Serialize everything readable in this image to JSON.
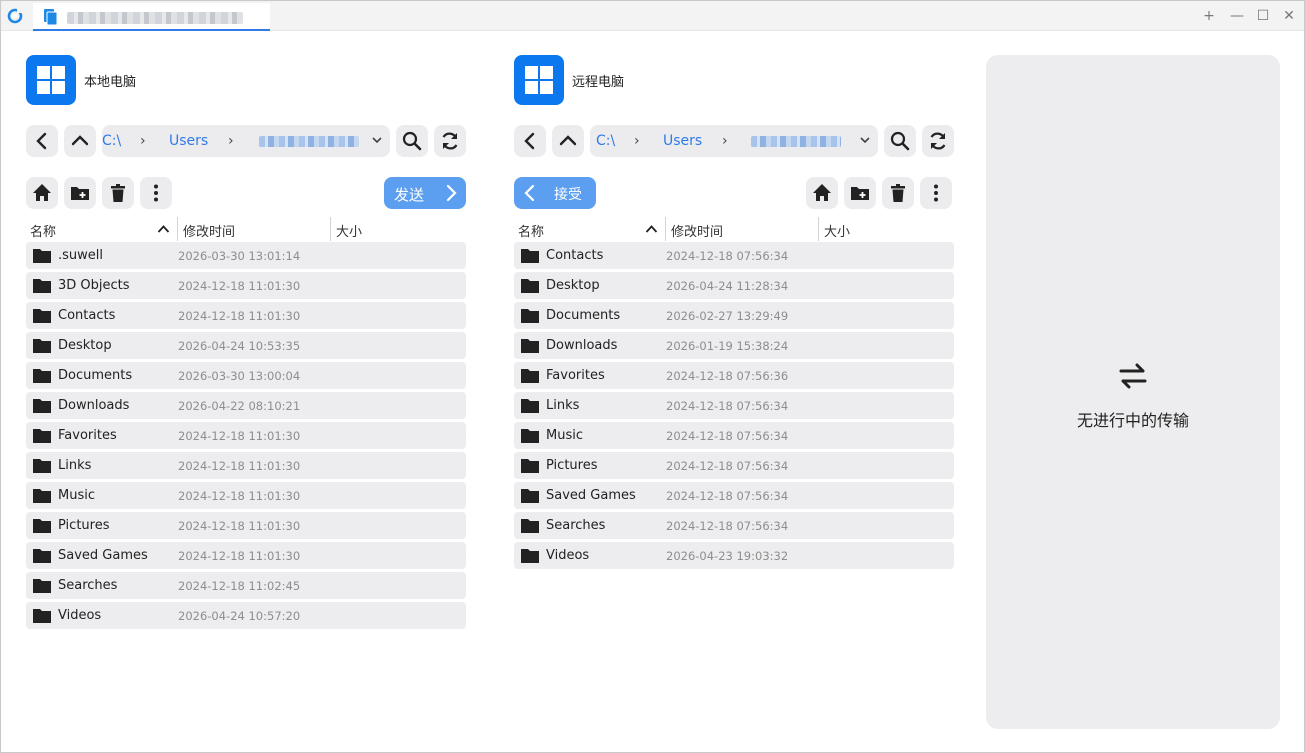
{
  "titlebar": {
    "tab_title": "",
    "new_tab": "+",
    "minimize": "—",
    "maximize": "☐",
    "close": "✕"
  },
  "colors": {
    "accent": "#2f7be8",
    "windows_blue": "#0b78f0",
    "button_blue": "#5c9ff0",
    "row_bg": "#ededef"
  },
  "local": {
    "title": "本地电脑",
    "path": {
      "drive": "C:\\",
      "folder": "Users"
    },
    "send_label": "发送",
    "columns": {
      "name": "名称",
      "modified": "修改时间",
      "size": "大小"
    },
    "files": [
      {
        "name": ".suwell",
        "date": "2026-03-30 13:01:14"
      },
      {
        "name": "3D Objects",
        "date": "2024-12-18 11:01:30"
      },
      {
        "name": "Contacts",
        "date": "2024-12-18 11:01:30"
      },
      {
        "name": "Desktop",
        "date": "2026-04-24 10:53:35"
      },
      {
        "name": "Documents",
        "date": "2026-03-30 13:00:04"
      },
      {
        "name": "Downloads",
        "date": "2026-04-22 08:10:21"
      },
      {
        "name": "Favorites",
        "date": "2024-12-18 11:01:30"
      },
      {
        "name": "Links",
        "date": "2024-12-18 11:01:30"
      },
      {
        "name": "Music",
        "date": "2024-12-18 11:01:30"
      },
      {
        "name": "Pictures",
        "date": "2024-12-18 11:01:30"
      },
      {
        "name": "Saved Games",
        "date": "2024-12-18 11:01:30"
      },
      {
        "name": "Searches",
        "date": "2024-12-18 11:02:45"
      },
      {
        "name": "Videos",
        "date": "2026-04-24 10:57:20"
      }
    ]
  },
  "remote": {
    "title": "远程电脑",
    "path": {
      "drive": "C:\\",
      "folder": "Users"
    },
    "receive_label": "接受",
    "columns": {
      "name": "名称",
      "modified": "修改时间",
      "size": "大小"
    },
    "files": [
      {
        "name": "Contacts",
        "date": "2024-12-18 07:56:34"
      },
      {
        "name": "Desktop",
        "date": "2026-04-24 11:28:34"
      },
      {
        "name": "Documents",
        "date": "2026-02-27 13:29:49"
      },
      {
        "name": "Downloads",
        "date": "2026-01-19 15:38:24"
      },
      {
        "name": "Favorites",
        "date": "2024-12-18 07:56:36"
      },
      {
        "name": "Links",
        "date": "2024-12-18 07:56:34"
      },
      {
        "name": "Music",
        "date": "2024-12-18 07:56:34"
      },
      {
        "name": "Pictures",
        "date": "2024-12-18 07:56:34"
      },
      {
        "name": "Saved Games",
        "date": "2024-12-18 07:56:34"
      },
      {
        "name": "Searches",
        "date": "2024-12-18 07:56:34"
      },
      {
        "name": "Videos",
        "date": "2026-04-23 19:03:32"
      }
    ]
  },
  "transfer": {
    "empty_text": "无进行中的传输"
  }
}
